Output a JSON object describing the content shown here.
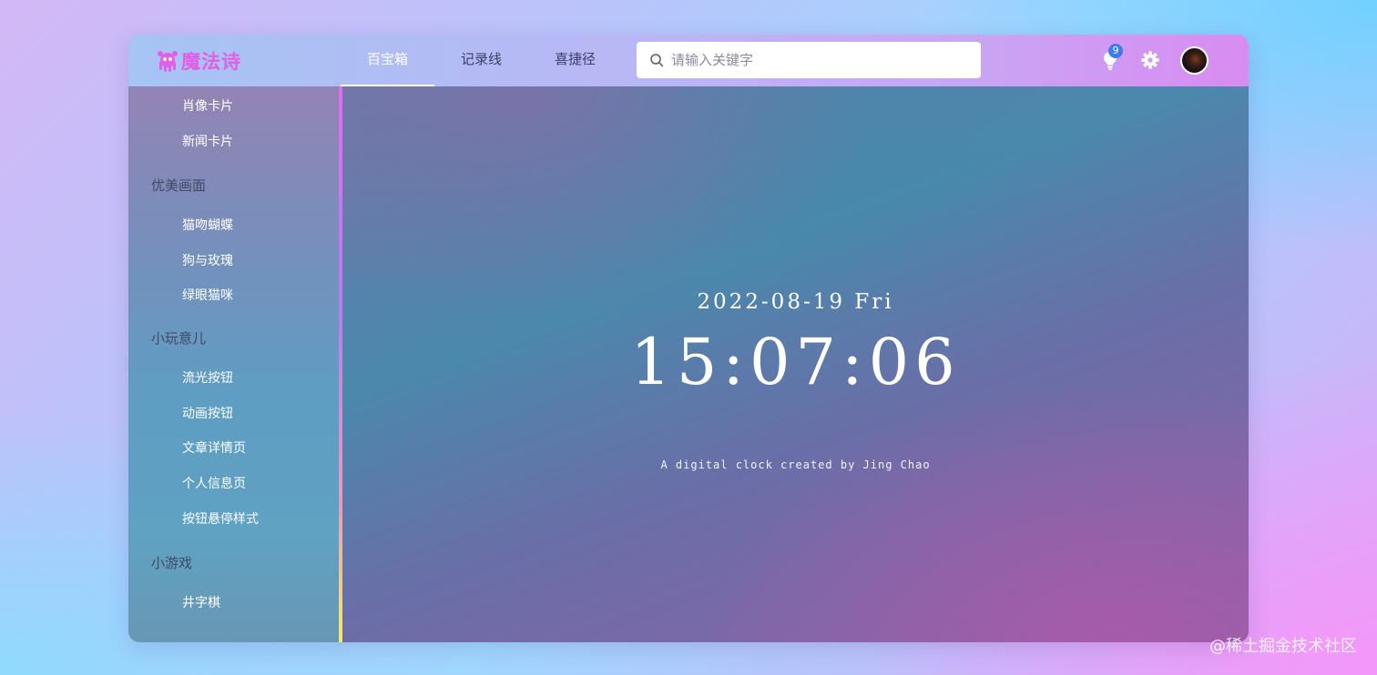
{
  "logo": {
    "text": "魔法诗"
  },
  "nav": {
    "items": [
      {
        "label": "百宝箱"
      },
      {
        "label": "记录线"
      },
      {
        "label": "喜捷径"
      }
    ]
  },
  "search": {
    "placeholder": "请输入关键字"
  },
  "notifications": {
    "count": "9"
  },
  "sidebar": {
    "items": [
      {
        "label": "肖像卡片"
      },
      {
        "label": "新闻卡片"
      },
      {
        "label": "优美画面"
      },
      {
        "label": "猫吻蝴蝶"
      },
      {
        "label": "狗与玫瑰"
      },
      {
        "label": "绿眼猫咪"
      },
      {
        "label": "小玩意儿"
      },
      {
        "label": "流光按钮"
      },
      {
        "label": "动画按钮"
      },
      {
        "label": "文章详情页"
      },
      {
        "label": "个人信息页"
      },
      {
        "label": "按钮悬停样式"
      },
      {
        "label": "小游戏"
      },
      {
        "label": "井字棋"
      }
    ]
  },
  "clock": {
    "date": "2022-08-19 Fri",
    "time": "15:07:06",
    "caption": "A digital clock created by Jing Chao"
  },
  "watermark": "@稀土掘金技术社区",
  "colors": {
    "logo": "#e25ee6",
    "badge": "#3b7cf0",
    "active_nav": "#ffffff"
  }
}
